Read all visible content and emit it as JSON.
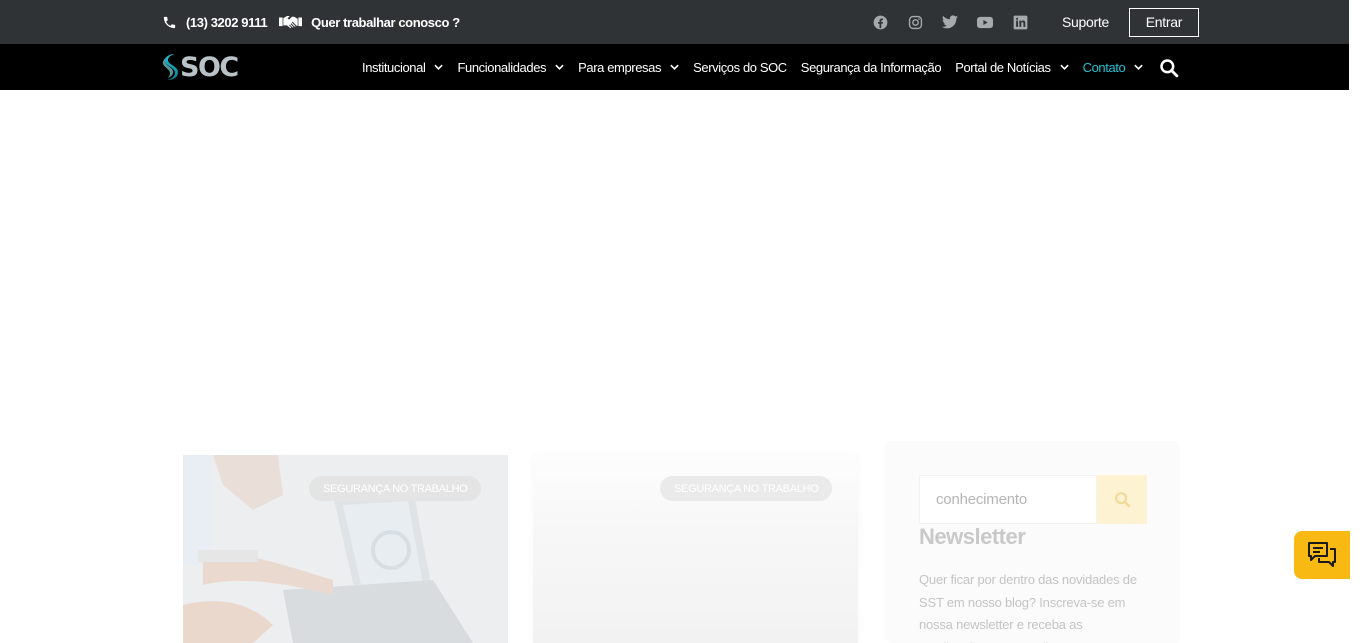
{
  "topbar": {
    "phone": "(13) 3202 9111",
    "jobs_link": "Quer trabalhar conosco ?",
    "social_icons": [
      "facebook-icon",
      "instagram-icon",
      "twitter-icon",
      "youtube-icon",
      "linkedin-icon"
    ],
    "support": "Suporte",
    "login": "Entrar"
  },
  "brand": {
    "logo_text": "SOC"
  },
  "nav": {
    "items": [
      {
        "label": "Institucional",
        "dropdown": true
      },
      {
        "label": "Funcionalidades",
        "dropdown": true
      },
      {
        "label": "Para empresas",
        "dropdown": true
      },
      {
        "label": "Serviços do SOC",
        "dropdown": false
      },
      {
        "label": "Segurança da Informação",
        "dropdown": false
      },
      {
        "label": "Portal de Notícias",
        "dropdown": true
      },
      {
        "label": "Contato",
        "dropdown": true,
        "active": true
      }
    ]
  },
  "cards": [
    {
      "category": "SEGURANÇA NO TRABALHO"
    },
    {
      "category": "SEGURANÇA NO TRABALHO"
    }
  ],
  "sidebar": {
    "search_value": "conhecimento",
    "newsletter_title": "Newsletter",
    "newsletter_text": "Quer ficar por dentro das novidades de SST em nosso blog? Inscreva-se em nossa newsletter e receba as atualizações por e-mail."
  },
  "colors": {
    "topbar_bg": "#2f3335",
    "nav_bg": "#000000",
    "accent": "#1fc2d6",
    "chat_button": "#f8b912"
  }
}
